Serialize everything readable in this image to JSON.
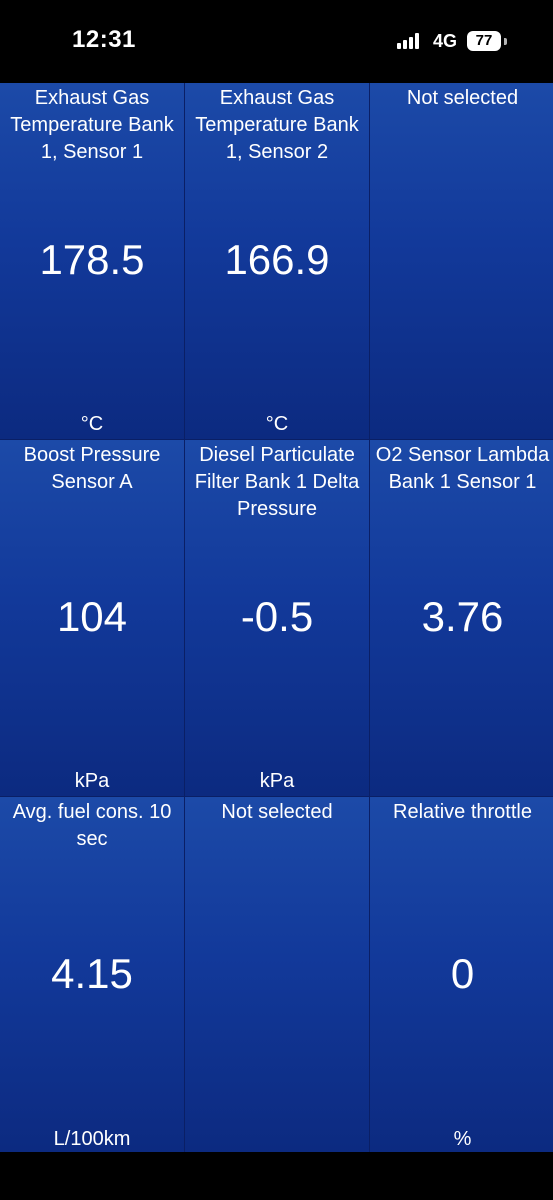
{
  "status_bar": {
    "time": "12:31",
    "network": "4G",
    "battery": "77"
  },
  "gauges": [
    {
      "title": "Exhaust Gas Temperature Bank 1, Sensor 1",
      "value": "178.5",
      "unit": "°C"
    },
    {
      "title": "Exhaust Gas Temperature Bank 1, Sensor 2",
      "value": "166.9",
      "unit": "°C"
    },
    {
      "title": "Not selected",
      "value": "",
      "unit": ""
    },
    {
      "title": "Boost Pressure Sensor A",
      "value": "104",
      "unit": "kPa"
    },
    {
      "title": "Diesel Particulate Filter Bank 1 Delta Pressure",
      "value": "-0.5",
      "unit": "kPa"
    },
    {
      "title": "O2 Sensor Lambda Bank 1 Sensor 1",
      "value": "3.76",
      "unit": ""
    },
    {
      "title": "Avg. fuel cons. 10 sec",
      "value": "4.15",
      "unit": "L/100km"
    },
    {
      "title": "Not selected",
      "value": "",
      "unit": ""
    },
    {
      "title": "Relative throttle",
      "value": "0",
      "unit": "%"
    }
  ],
  "colors": {
    "tile_top": "#1c4aa8",
    "tile_bottom": "#0c2a80",
    "background": "#000000"
  }
}
